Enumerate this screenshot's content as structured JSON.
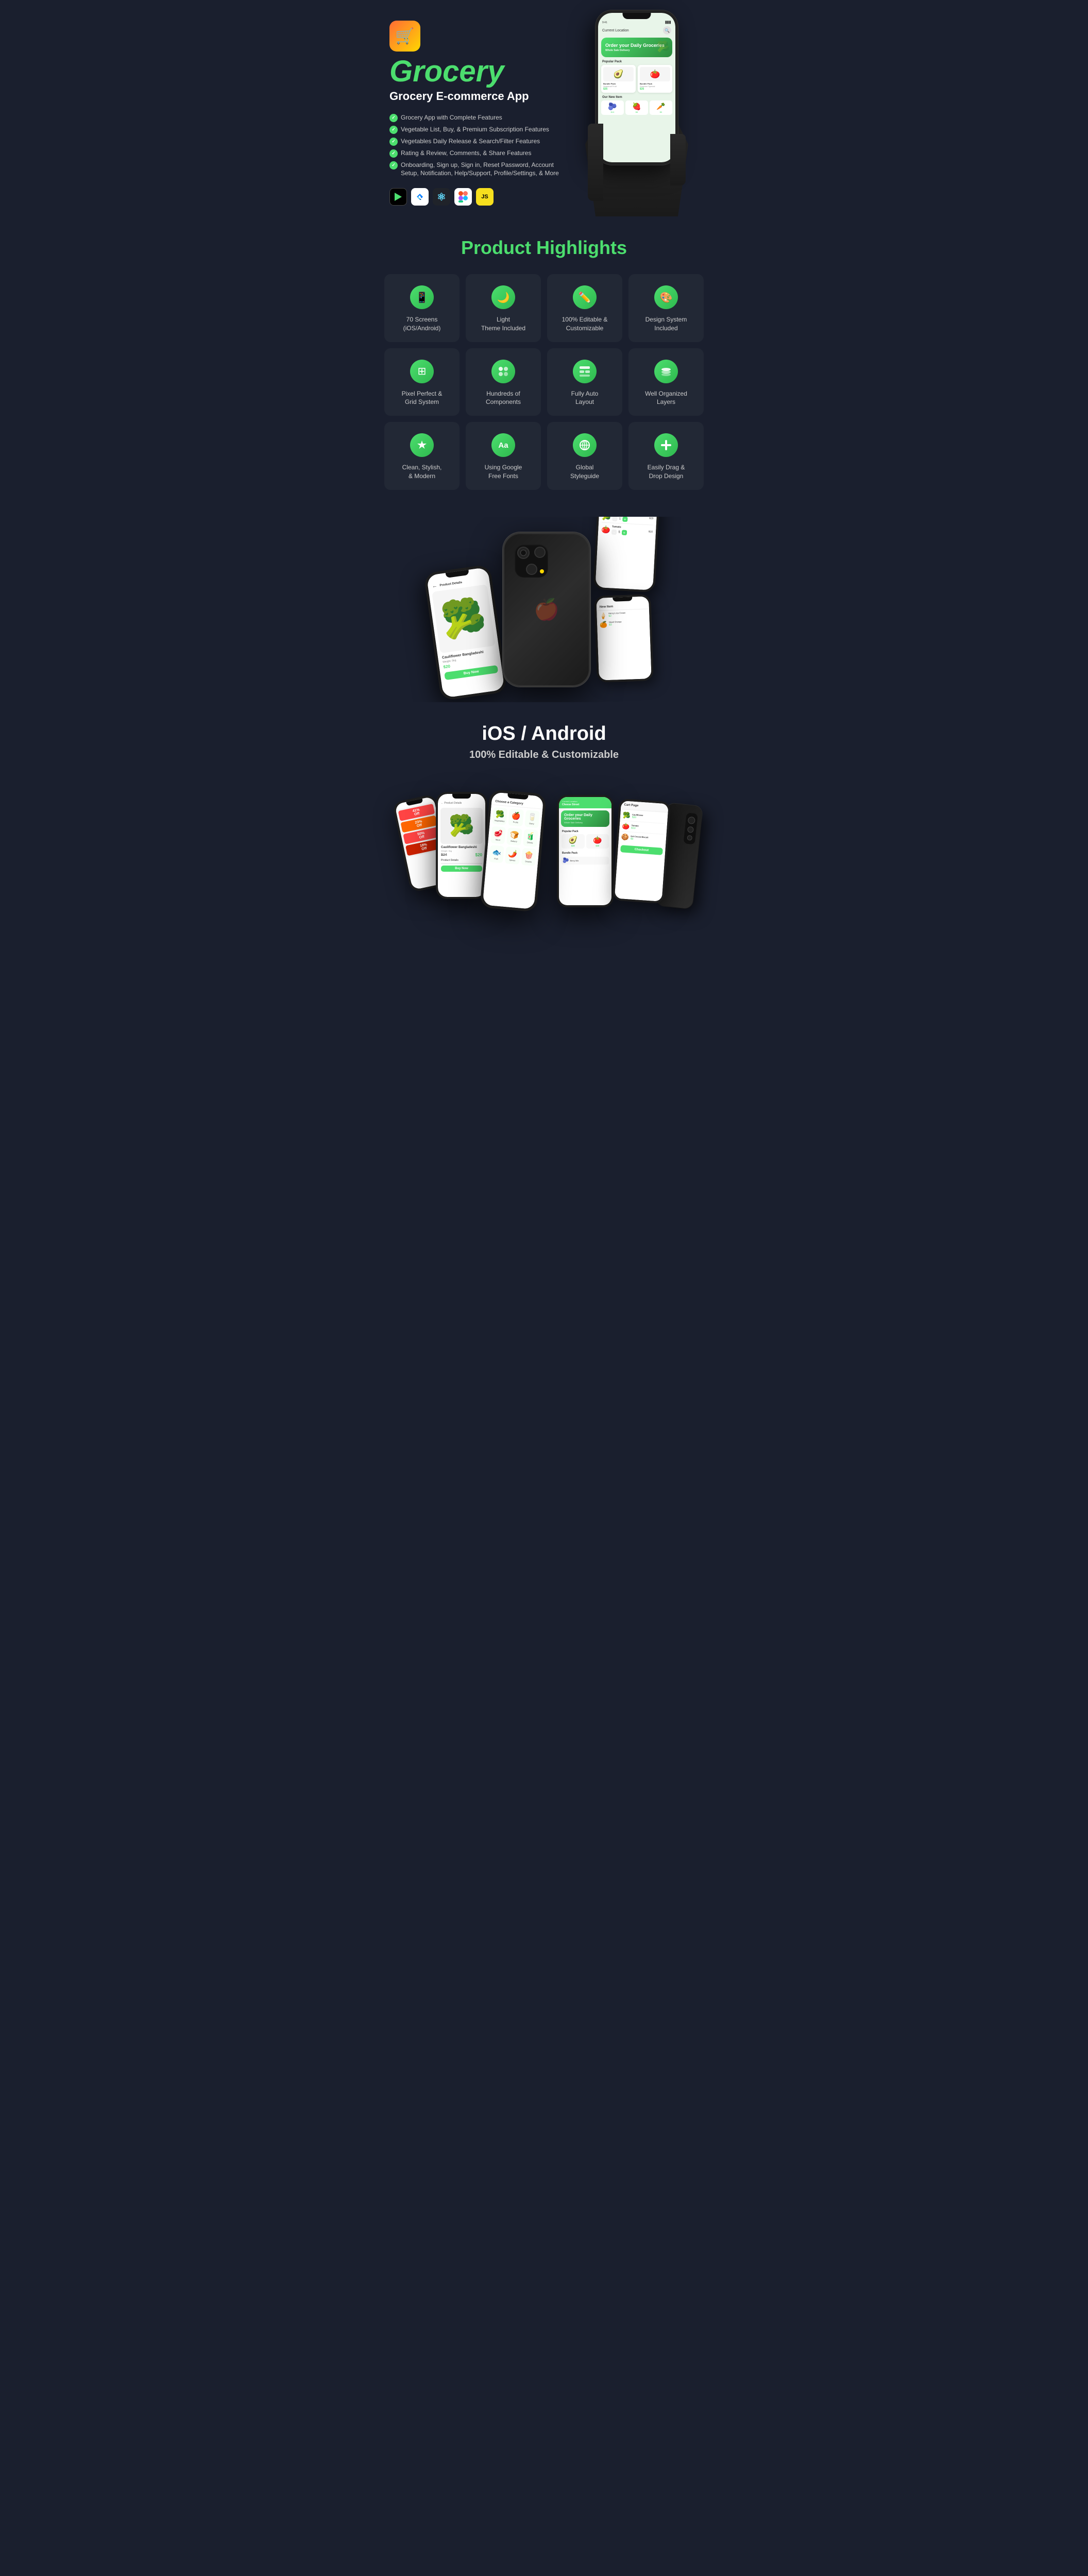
{
  "app": {
    "icon": "🛒",
    "title": "Grocery",
    "subtitle": "Grocery E-commerce App",
    "features": [
      "Grocery App with Complete Features",
      "Vegetable List, Buy, & Premium Subscription Features",
      "Vegetables Daily Release & Search/Filter Features",
      "Rating & Review, Comments, & Share Features",
      "Onboarding, Sign up, Sign in, Reset Password, Account Setup, Notification, Help/Support, Profile/Settings, & More"
    ],
    "tech_badges": [
      "▶",
      "f",
      "⚛",
      "◆",
      "JS"
    ]
  },
  "highlights": {
    "section_title": "Product Highlights",
    "items_row1": [
      {
        "icon": "📱",
        "label": "70 Screens\n(iOS/Android)"
      },
      {
        "icon": "🌙",
        "label": "Light\nTheme Included"
      },
      {
        "icon": "✏️",
        "label": "100% Editable &\nCustomizable"
      },
      {
        "icon": "🎨",
        "label": "Design System\nIncluded"
      }
    ],
    "items_row2": [
      {
        "icon": "⊞",
        "label": "Pixel Perfect &\nGrid System"
      },
      {
        "icon": "⊛",
        "label": "Hundreds of\nComponents"
      },
      {
        "icon": "▤",
        "label": "Fully Auto\nLayout"
      },
      {
        "icon": "⬡",
        "label": "Well Organized\nLayers"
      }
    ],
    "items_row3": [
      {
        "icon": "✦",
        "label": "Clean, Stylish,\n& Modern"
      },
      {
        "icon": "Aa",
        "label": "Using Google\nFree Fonts"
      },
      {
        "icon": "⊕",
        "label": "Global\nStyleguide"
      },
      {
        "icon": "✚",
        "label": "Easily Drag &\nDrop Design"
      }
    ]
  },
  "platform": {
    "title": "iOS / Android",
    "subtitle": "100% Editable & Customizable"
  },
  "colors": {
    "accent_green": "#4cde6e",
    "bg_dark": "#1a1f2e",
    "card_bg": "#222835",
    "text_light": "#cccccc",
    "red": "#ff4444"
  },
  "screen_content": {
    "order_title": "Order your Daily Groceries",
    "popular_pack": "Popular Pack",
    "bundle_pack": "Bundle Pack",
    "our_new_item": "Our New Item",
    "product_detail": "Product Details",
    "cauliflower": "Cauliflower Bangladeshi",
    "cart_page": "Cart Page",
    "new_item": "New Item",
    "choose_category": "Choose a Category",
    "weight_5kg": "Weight: 5kg",
    "price_20": "$20",
    "price_35": "$35",
    "price_10": "$10"
  }
}
